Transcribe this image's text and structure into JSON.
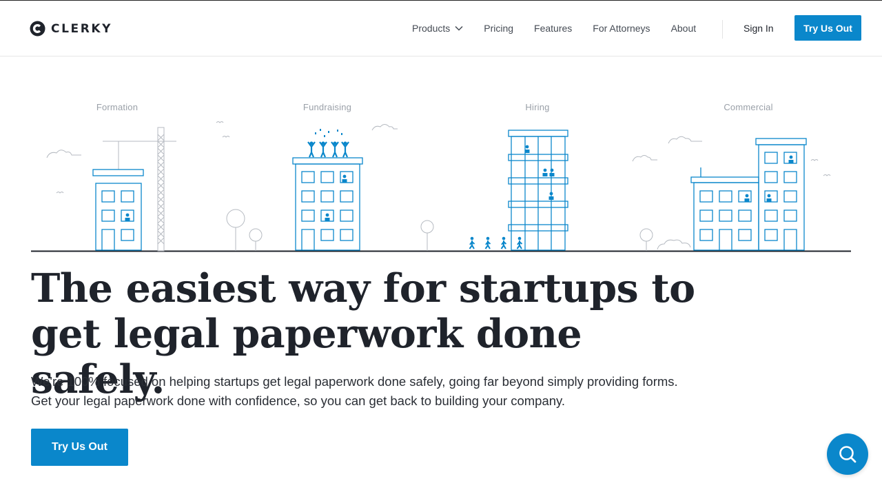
{
  "brand": {
    "name": "CLERKY"
  },
  "nav": {
    "items": [
      {
        "label": "Products",
        "has_dropdown": true
      },
      {
        "label": "Pricing"
      },
      {
        "label": "Features"
      },
      {
        "label": "For Attorneys"
      },
      {
        "label": "About"
      }
    ],
    "sign_in": "Sign In",
    "cta": "Try Us Out"
  },
  "illustration": {
    "labels": [
      "Formation",
      "Fundraising",
      "Hiring",
      "Commercial"
    ]
  },
  "hero": {
    "headline_line1": "The easiest way for startups to",
    "headline_line2": "get legal paperwork done safely.",
    "subcopy_line1": "We're 100% focused on helping startups get legal paperwork done safely, going far beyond simply providing forms.",
    "subcopy_line2": "Get your legal paperwork done with confidence, so you can get back to building your company.",
    "cta": "Try Us Out"
  },
  "colors": {
    "accent": "#0a87cb",
    "text": "#1f232b",
    "muted": "#9aa0a8"
  },
  "icons": {
    "chat": "search-chat-icon",
    "dropdown": "chevron-down-icon",
    "logo": "clerky-logo-icon"
  }
}
